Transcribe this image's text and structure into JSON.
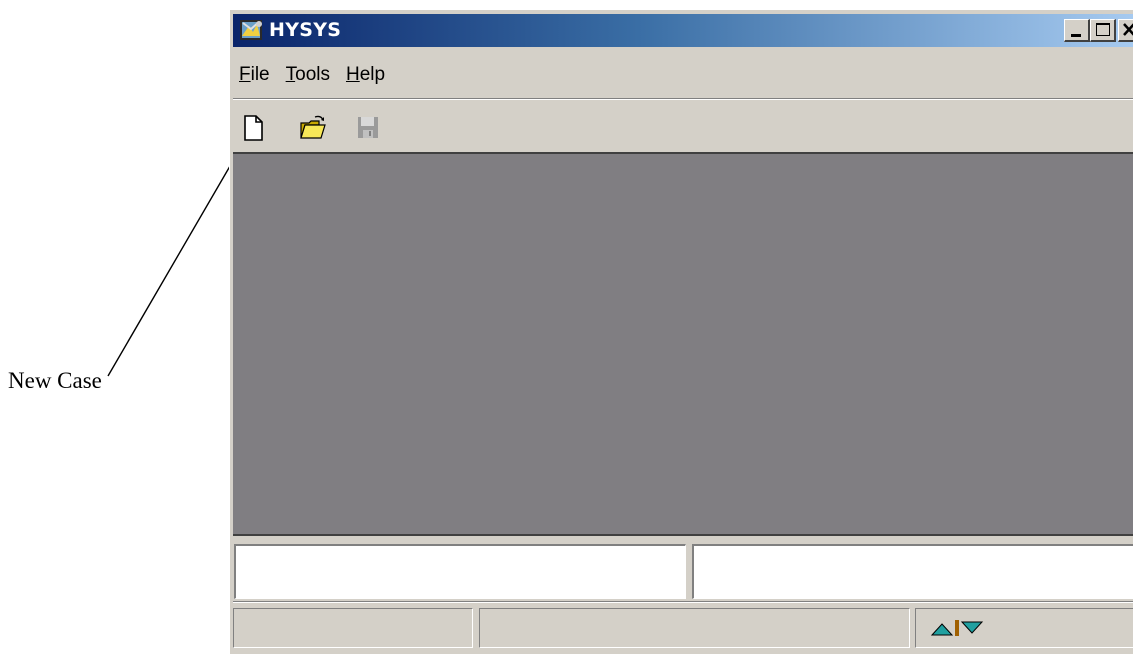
{
  "annotation": {
    "label": "New Case"
  },
  "window": {
    "title": "HYSYS",
    "controls": {
      "minimize_icon": "minimize-icon",
      "maximize_icon": "maximize-icon",
      "close_icon": "close-icon"
    }
  },
  "menu": {
    "items": [
      {
        "mnemonic": "F",
        "rest": "ile"
      },
      {
        "mnemonic": "T",
        "rest": "ools"
      },
      {
        "mnemonic": "H",
        "rest": "elp"
      }
    ]
  },
  "toolbar": {
    "buttons": [
      {
        "icon": "new-document-icon"
      },
      {
        "icon": "open-folder-icon"
      },
      {
        "icon": "save-disk-icon",
        "disabled": true
      }
    ]
  },
  "statusbar": {
    "spinner_icon": "up-down-arrows-icon"
  },
  "colors": {
    "title_gradient_start": "#0a246a",
    "title_gradient_end": "#a6caf0",
    "chrome": "#d4d0c8",
    "workspace": "#807e82"
  }
}
